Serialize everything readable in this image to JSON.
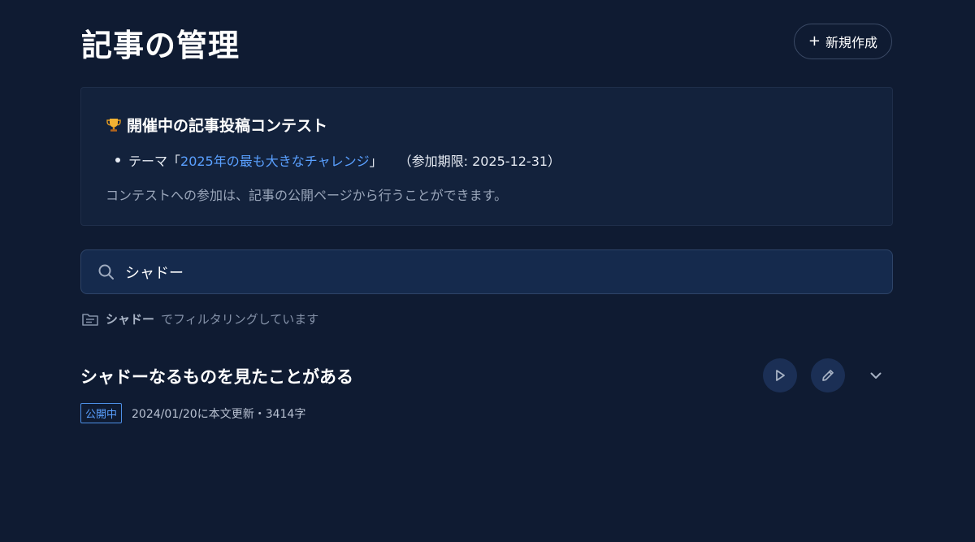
{
  "header": {
    "title": "記事の管理",
    "new_button_icon": "+",
    "new_button_label": "新規作成"
  },
  "contest": {
    "icon": "trophy-icon",
    "title": "開催中の記事投稿コンテスト",
    "theme_prefix": "テーマ「",
    "theme_link": "2025年の最も大きなチャレンジ",
    "theme_suffix": "」",
    "deadline": "（参加期限: 2025-12-31）",
    "note": "コンテストへの参加は、記事の公開ページから行うことができます。"
  },
  "search": {
    "value": "シャドー"
  },
  "filter": {
    "icon": "folder-icon",
    "term": "シャドー",
    "text": "でフィルタリングしています"
  },
  "articles": [
    {
      "title": "シャドーなるものを見たことがある",
      "status": "公開中",
      "meta": "2024/01/20に本文更新・3414字"
    }
  ],
  "colors": {
    "background": "#0f1b32",
    "accent": "#5aa0ff"
  }
}
